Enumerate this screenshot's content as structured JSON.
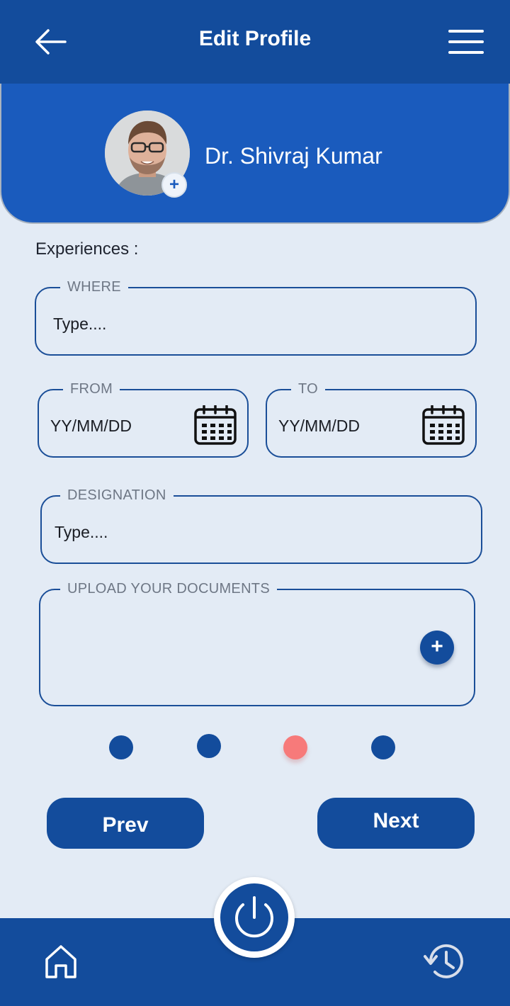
{
  "header": {
    "title": "Edit Profile",
    "back_icon": "arrow-left-icon",
    "menu_icon": "hamburger-menu-icon"
  },
  "profile": {
    "name": "Dr. Shivraj Kumar",
    "avatar_add_symbol": "+"
  },
  "form": {
    "section_label": "Experiences :",
    "where": {
      "label": "WHERE",
      "placeholder": "Type...."
    },
    "from": {
      "label": "FROM",
      "placeholder": "YY/MM/DD"
    },
    "to": {
      "label": "TO",
      "placeholder": "YY/MM/DD"
    },
    "designation": {
      "label": "DESIGNATION",
      "placeholder": "Type...."
    },
    "upload": {
      "label": "UPLOAD YOUR DOCUMENTS",
      "add_symbol": "+"
    }
  },
  "stepper": {
    "total_steps": 4,
    "current_step": 3
  },
  "buttons": {
    "prev": "Prev",
    "next": "Next"
  },
  "bottom_nav": {
    "home_icon": "home-icon",
    "power_icon": "power-icon",
    "history_icon": "history-icon"
  },
  "colors": {
    "primary": "#134c9c",
    "card_blue": "#1a5bbd",
    "background": "#e3ebf5",
    "active_dot": "#f77a7a",
    "text_dark": "#1f2430",
    "legend_gray": "#6e7785"
  }
}
